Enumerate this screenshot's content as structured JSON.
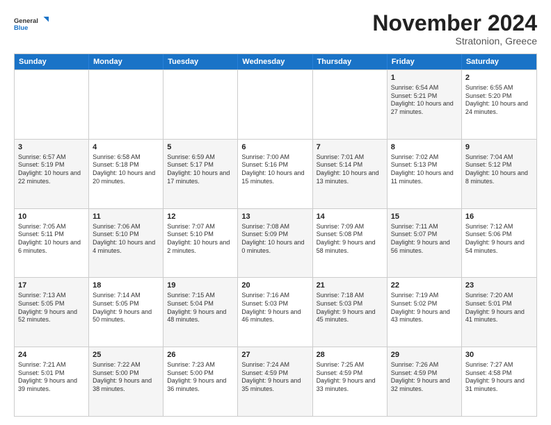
{
  "logo": {
    "line1": "General",
    "line2": "Blue"
  },
  "header": {
    "month": "November 2024",
    "location": "Stratonion, Greece"
  },
  "days": [
    "Sunday",
    "Monday",
    "Tuesday",
    "Wednesday",
    "Thursday",
    "Friday",
    "Saturday"
  ],
  "weeks": [
    [
      {
        "day": "",
        "content": "",
        "shaded": false
      },
      {
        "day": "",
        "content": "",
        "shaded": false
      },
      {
        "day": "",
        "content": "",
        "shaded": false
      },
      {
        "day": "",
        "content": "",
        "shaded": false
      },
      {
        "day": "",
        "content": "",
        "shaded": false
      },
      {
        "day": "1",
        "content": "Sunrise: 6:54 AM\nSunset: 5:21 PM\nDaylight: 10 hours and 27 minutes.",
        "shaded": true
      },
      {
        "day": "2",
        "content": "Sunrise: 6:55 AM\nSunset: 5:20 PM\nDaylight: 10 hours and 24 minutes.",
        "shaded": false
      }
    ],
    [
      {
        "day": "3",
        "content": "Sunrise: 6:57 AM\nSunset: 5:19 PM\nDaylight: 10 hours and 22 minutes.",
        "shaded": true
      },
      {
        "day": "4",
        "content": "Sunrise: 6:58 AM\nSunset: 5:18 PM\nDaylight: 10 hours and 20 minutes.",
        "shaded": false
      },
      {
        "day": "5",
        "content": "Sunrise: 6:59 AM\nSunset: 5:17 PM\nDaylight: 10 hours and 17 minutes.",
        "shaded": true
      },
      {
        "day": "6",
        "content": "Sunrise: 7:00 AM\nSunset: 5:16 PM\nDaylight: 10 hours and 15 minutes.",
        "shaded": false
      },
      {
        "day": "7",
        "content": "Sunrise: 7:01 AM\nSunset: 5:14 PM\nDaylight: 10 hours and 13 minutes.",
        "shaded": true
      },
      {
        "day": "8",
        "content": "Sunrise: 7:02 AM\nSunset: 5:13 PM\nDaylight: 10 hours and 11 minutes.",
        "shaded": false
      },
      {
        "day": "9",
        "content": "Sunrise: 7:04 AM\nSunset: 5:12 PM\nDaylight: 10 hours and 8 minutes.",
        "shaded": true
      }
    ],
    [
      {
        "day": "10",
        "content": "Sunrise: 7:05 AM\nSunset: 5:11 PM\nDaylight: 10 hours and 6 minutes.",
        "shaded": false
      },
      {
        "day": "11",
        "content": "Sunrise: 7:06 AM\nSunset: 5:10 PM\nDaylight: 10 hours and 4 minutes.",
        "shaded": true
      },
      {
        "day": "12",
        "content": "Sunrise: 7:07 AM\nSunset: 5:10 PM\nDaylight: 10 hours and 2 minutes.",
        "shaded": false
      },
      {
        "day": "13",
        "content": "Sunrise: 7:08 AM\nSunset: 5:09 PM\nDaylight: 10 hours and 0 minutes.",
        "shaded": true
      },
      {
        "day": "14",
        "content": "Sunrise: 7:09 AM\nSunset: 5:08 PM\nDaylight: 9 hours and 58 minutes.",
        "shaded": false
      },
      {
        "day": "15",
        "content": "Sunrise: 7:11 AM\nSunset: 5:07 PM\nDaylight: 9 hours and 56 minutes.",
        "shaded": true
      },
      {
        "day": "16",
        "content": "Sunrise: 7:12 AM\nSunset: 5:06 PM\nDaylight: 9 hours and 54 minutes.",
        "shaded": false
      }
    ],
    [
      {
        "day": "17",
        "content": "Sunrise: 7:13 AM\nSunset: 5:05 PM\nDaylight: 9 hours and 52 minutes.",
        "shaded": true
      },
      {
        "day": "18",
        "content": "Sunrise: 7:14 AM\nSunset: 5:05 PM\nDaylight: 9 hours and 50 minutes.",
        "shaded": false
      },
      {
        "day": "19",
        "content": "Sunrise: 7:15 AM\nSunset: 5:04 PM\nDaylight: 9 hours and 48 minutes.",
        "shaded": true
      },
      {
        "day": "20",
        "content": "Sunrise: 7:16 AM\nSunset: 5:03 PM\nDaylight: 9 hours and 46 minutes.",
        "shaded": false
      },
      {
        "day": "21",
        "content": "Sunrise: 7:18 AM\nSunset: 5:03 PM\nDaylight: 9 hours and 45 minutes.",
        "shaded": true
      },
      {
        "day": "22",
        "content": "Sunrise: 7:19 AM\nSunset: 5:02 PM\nDaylight: 9 hours and 43 minutes.",
        "shaded": false
      },
      {
        "day": "23",
        "content": "Sunrise: 7:20 AM\nSunset: 5:01 PM\nDaylight: 9 hours and 41 minutes.",
        "shaded": true
      }
    ],
    [
      {
        "day": "24",
        "content": "Sunrise: 7:21 AM\nSunset: 5:01 PM\nDaylight: 9 hours and 39 minutes.",
        "shaded": false
      },
      {
        "day": "25",
        "content": "Sunrise: 7:22 AM\nSunset: 5:00 PM\nDaylight: 9 hours and 38 minutes.",
        "shaded": true
      },
      {
        "day": "26",
        "content": "Sunrise: 7:23 AM\nSunset: 5:00 PM\nDaylight: 9 hours and 36 minutes.",
        "shaded": false
      },
      {
        "day": "27",
        "content": "Sunrise: 7:24 AM\nSunset: 4:59 PM\nDaylight: 9 hours and 35 minutes.",
        "shaded": true
      },
      {
        "day": "28",
        "content": "Sunrise: 7:25 AM\nSunset: 4:59 PM\nDaylight: 9 hours and 33 minutes.",
        "shaded": false
      },
      {
        "day": "29",
        "content": "Sunrise: 7:26 AM\nSunset: 4:59 PM\nDaylight: 9 hours and 32 minutes.",
        "shaded": true
      },
      {
        "day": "30",
        "content": "Sunrise: 7:27 AM\nSunset: 4:58 PM\nDaylight: 9 hours and 31 minutes.",
        "shaded": false
      }
    ]
  ]
}
